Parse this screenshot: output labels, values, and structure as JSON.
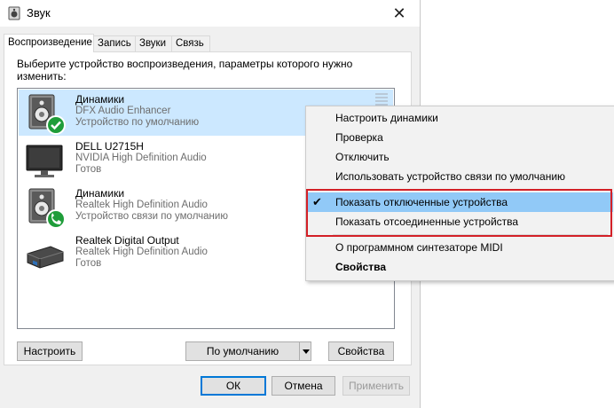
{
  "window": {
    "title": "Звук"
  },
  "tabs": [
    {
      "label": "Воспроизведение",
      "active": true
    },
    {
      "label": "Запись",
      "active": false
    },
    {
      "label": "Звуки",
      "active": false
    },
    {
      "label": "Связь",
      "active": false
    }
  ],
  "instruction": "Выберите устройство воспроизведения, параметры которого нужно изменить:",
  "devices": [
    {
      "name": "Динамики",
      "driver": "DFX Audio Enhancer",
      "status": "Устройство по умолчанию",
      "icon": "speaker-icon",
      "badge": "check-badge-icon",
      "selected": true
    },
    {
      "name": "DELL U2715H",
      "driver": "NVIDIA High Definition Audio",
      "status": "Готов",
      "icon": "monitor-icon",
      "selected": false
    },
    {
      "name": "Динамики",
      "driver": "Realtek High Definition Audio",
      "status": "Устройство связи по умолчанию",
      "icon": "speaker-icon",
      "badge": "phone-badge-icon",
      "selected": false
    },
    {
      "name": "Realtek Digital Output",
      "driver": "Realtek High Definition Audio",
      "status": "Готов",
      "icon": "digital-output-icon",
      "selected": false
    }
  ],
  "buttons": {
    "configure": "Настроить",
    "set_default": "По умолчанию",
    "properties": "Свойства",
    "ok": "ОК",
    "cancel": "Отмена",
    "apply": "Применить"
  },
  "context_menu": {
    "items": [
      {
        "label": "Настроить динамики"
      },
      {
        "label": "Проверка"
      },
      {
        "label": "Отключить"
      },
      {
        "label": "Использовать устройство связи по умолчанию"
      },
      {
        "label": "Показать отключенные устройства",
        "checked": true,
        "highlighted": true
      },
      {
        "label": "Показать отсоединенные устройства"
      },
      {
        "label": "О программном синтезаторе MIDI"
      },
      {
        "label": "Свойства",
        "bold": true
      }
    ]
  },
  "colors": {
    "selection": "#cce8ff",
    "menu_highlight": "#91c9f7",
    "annotation_box": "#d32027",
    "default_button_border": "#0078d7",
    "badge_green": "#1f9d3a"
  }
}
